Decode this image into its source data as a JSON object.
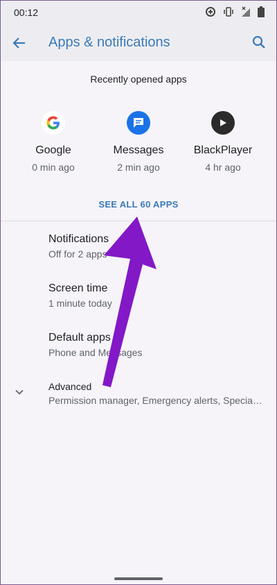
{
  "status_bar": {
    "time": "00:12"
  },
  "app_bar": {
    "title": "Apps & notifications"
  },
  "recent": {
    "title": "Recently opened apps",
    "apps": [
      {
        "name": "Google",
        "time": "0 min ago"
      },
      {
        "name": "Messages",
        "time": "2 min ago"
      },
      {
        "name": "BlackPlayer",
        "time": "4 hr ago"
      }
    ],
    "see_all": "SEE ALL 60 APPS"
  },
  "settings": [
    {
      "title": "Notifications",
      "summary": "Off for 2 apps"
    },
    {
      "title": "Screen time",
      "summary": "1 minute today"
    },
    {
      "title": "Default apps",
      "summary": "Phone and Messages"
    },
    {
      "title": "Advanced",
      "summary": "Permission manager, Emergency alerts, Special app access"
    }
  ],
  "colors": {
    "accent": "#3a7ab8",
    "arrow": "#8318c7",
    "background": "#f6f4f9"
  }
}
